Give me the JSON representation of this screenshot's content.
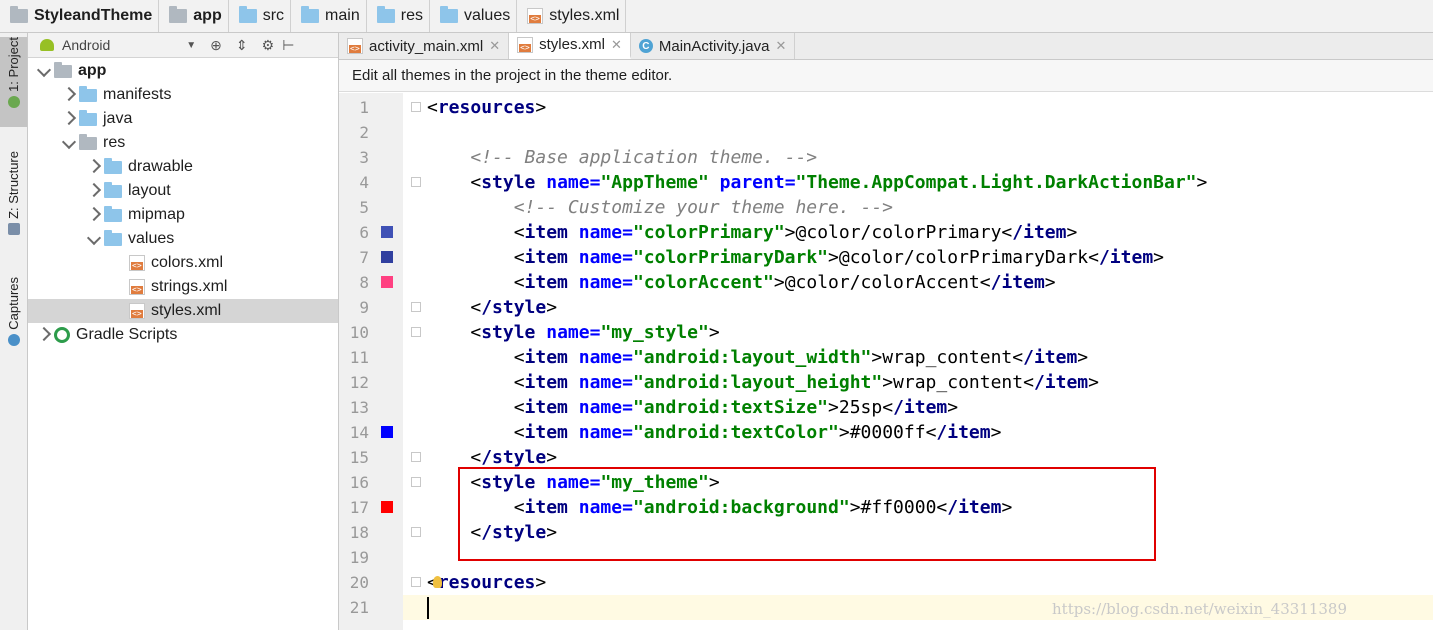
{
  "breadcrumbs": [
    {
      "label": "StyleandTheme",
      "icon": "project-folder-icon",
      "bold": true
    },
    {
      "label": "app",
      "icon": "module-folder-icon",
      "bold": true
    },
    {
      "label": "src",
      "icon": "folder-icon",
      "bold": false
    },
    {
      "label": "main",
      "icon": "folder-icon",
      "bold": false
    },
    {
      "label": "res",
      "icon": "folder-icon",
      "bold": false
    },
    {
      "label": "values",
      "icon": "folder-icon",
      "bold": false
    },
    {
      "label": "styles.xml",
      "icon": "xml-file-icon",
      "bold": false
    }
  ],
  "toolstrip": {
    "project": "1: Project",
    "structure": "Z: Structure",
    "captures": "Captures"
  },
  "panel": {
    "view": "Android"
  },
  "tree": [
    {
      "label": "app",
      "depth": 0,
      "expanded": true,
      "icon": "module-folder-icon",
      "bold": true
    },
    {
      "label": "manifests",
      "depth": 1,
      "expanded": false,
      "icon": "folder-icon"
    },
    {
      "label": "java",
      "depth": 1,
      "expanded": false,
      "icon": "folder-icon"
    },
    {
      "label": "res",
      "depth": 1,
      "expanded": true,
      "icon": "res-folder-icon"
    },
    {
      "label": "drawable",
      "depth": 2,
      "expanded": false,
      "icon": "folder-icon"
    },
    {
      "label": "layout",
      "depth": 2,
      "expanded": false,
      "icon": "folder-icon"
    },
    {
      "label": "mipmap",
      "depth": 2,
      "expanded": false,
      "icon": "folder-icon"
    },
    {
      "label": "values",
      "depth": 2,
      "expanded": true,
      "icon": "folder-icon"
    },
    {
      "label": "colors.xml",
      "depth": 3,
      "leaf": true,
      "icon": "xml-file-icon"
    },
    {
      "label": "strings.xml",
      "depth": 3,
      "leaf": true,
      "icon": "xml-file-icon"
    },
    {
      "label": "styles.xml",
      "depth": 3,
      "leaf": true,
      "icon": "xml-file-icon",
      "selected": true
    },
    {
      "label": "Gradle Scripts",
      "depth": 0,
      "expanded": false,
      "icon": "gradle-icon"
    }
  ],
  "tabs": [
    {
      "label": "activity_main.xml",
      "icon": "xml-file-icon",
      "active": false
    },
    {
      "label": "styles.xml",
      "icon": "xml-file-icon",
      "active": true
    },
    {
      "label": "MainActivity.java",
      "icon": "class-icon",
      "active": false
    }
  ],
  "notice": "Edit all themes in the project in the theme editor.",
  "lines": [
    {
      "n": "1",
      "code": "<resources>"
    },
    {
      "n": "2",
      "code": ""
    },
    {
      "n": "3",
      "code": "    <!-- Base application theme. -->"
    },
    {
      "n": "4",
      "code": "    <style name=\"AppTheme\" parent=\"Theme.AppCompat.Light.DarkActionBar\">"
    },
    {
      "n": "5",
      "code": "        <!-- Customize your theme here. -->"
    },
    {
      "n": "6",
      "code": "        <item name=\"colorPrimary\">@color/colorPrimary</item>",
      "swatch": "#3f51b5"
    },
    {
      "n": "7",
      "code": "        <item name=\"colorPrimaryDark\">@color/colorPrimaryDark</item>",
      "swatch": "#303f9f"
    },
    {
      "n": "8",
      "code": "        <item name=\"colorAccent\">@color/colorAccent</item>",
      "swatch": "#ff4081"
    },
    {
      "n": "9",
      "code": "    </style>"
    },
    {
      "n": "10",
      "code": "    <style name=\"my_style\">"
    },
    {
      "n": "11",
      "code": "        <item name=\"android:layout_width\">wrap_content</item>"
    },
    {
      "n": "12",
      "code": "        <item name=\"android:layout_height\">wrap_content</item>"
    },
    {
      "n": "13",
      "code": "        <item name=\"android:textSize\">25sp</item>"
    },
    {
      "n": "14",
      "code": "        <item name=\"android:textColor\">#0000ff</item>",
      "swatch": "#0000ff"
    },
    {
      "n": "15",
      "code": "    </style>"
    },
    {
      "n": "16",
      "code": "    <style name=\"my_theme\">"
    },
    {
      "n": "17",
      "code": "        <item name=\"android:background\">#ff0000</item>",
      "swatch": "#ff0000"
    },
    {
      "n": "18",
      "code": "    </style>"
    },
    {
      "n": "19",
      "code": ""
    },
    {
      "n": "20",
      "code": "<resources>"
    },
    {
      "n": "21",
      "code": ""
    }
  ],
  "watermark": "https://blog.csdn.net/weixin_43311389"
}
